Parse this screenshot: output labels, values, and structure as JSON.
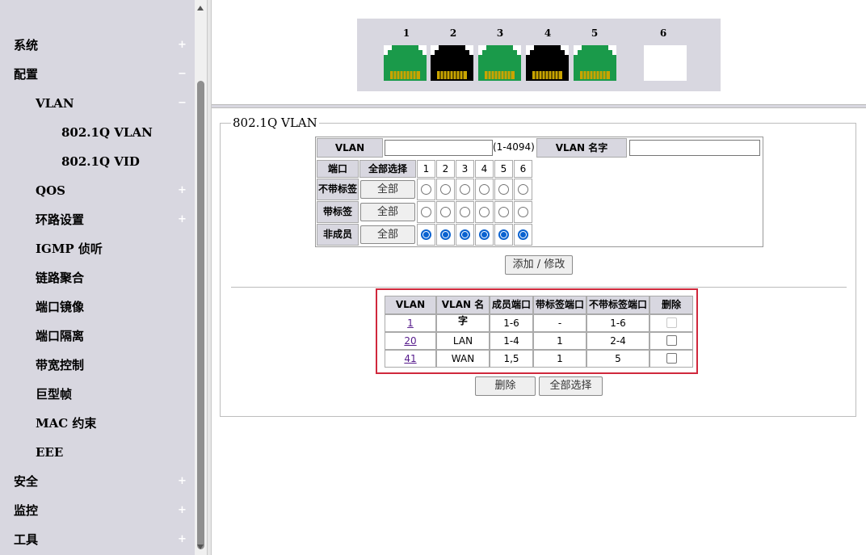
{
  "sidebar": {
    "items": [
      {
        "label": "系统",
        "sign": "+"
      },
      {
        "label": "配置",
        "sign": "−"
      },
      {
        "label": "VLAN",
        "sign": "−"
      },
      {
        "label": "802.1Q VLAN",
        "sign": ""
      },
      {
        "label": "802.1Q VID",
        "sign": ""
      },
      {
        "label": "QOS",
        "sign": "+"
      },
      {
        "label": "环路设置",
        "sign": "+"
      },
      {
        "label": "IGMP 侦听",
        "sign": ""
      },
      {
        "label": "链路聚合",
        "sign": ""
      },
      {
        "label": "端口镜像",
        "sign": ""
      },
      {
        "label": "端口隔离",
        "sign": ""
      },
      {
        "label": "带宽控制",
        "sign": ""
      },
      {
        "label": "巨型帧",
        "sign": ""
      },
      {
        "label": "MAC 约束",
        "sign": ""
      },
      {
        "label": "EEE",
        "sign": ""
      },
      {
        "label": "安全",
        "sign": "+"
      },
      {
        "label": "监控",
        "sign": "+"
      },
      {
        "label": "工具",
        "sign": "+"
      }
    ]
  },
  "ports": [
    {
      "num": "1",
      "status": "up"
    },
    {
      "num": "2",
      "status": "down"
    },
    {
      "num": "3",
      "status": "up"
    },
    {
      "num": "4",
      "status": "down"
    },
    {
      "num": "5",
      "status": "up"
    },
    {
      "num": "6",
      "status": "empty"
    }
  ],
  "colors": {
    "port_up": "#1a9a4a",
    "port_down": "#000000",
    "accent": "#0a62d0",
    "highlight": "#d0283c"
  },
  "form": {
    "legend": "802.1Q VLAN",
    "vlan_label": "VLAN",
    "vlan_value": "",
    "vlan_range": "(1-4094)",
    "name_label": "VLAN 名字",
    "name_value": "",
    "port_col": "端口",
    "select_all_col": "全部选择",
    "port_numbers": [
      "1",
      "2",
      "3",
      "4",
      "5",
      "6"
    ],
    "rows": [
      {
        "label": "不带标签",
        "button": "全部",
        "selected": [
          false,
          false,
          false,
          false,
          false,
          false
        ]
      },
      {
        "label": "带标签",
        "button": "全部",
        "selected": [
          false,
          false,
          false,
          false,
          false,
          false
        ]
      },
      {
        "label": "非成员",
        "button": "全部",
        "selected": [
          true,
          true,
          true,
          true,
          true,
          true
        ]
      }
    ],
    "add_button": "添加 / 修改"
  },
  "vlan_list": {
    "headers": [
      "VLAN",
      "VLAN 名字",
      "成员端口",
      "带标签端口",
      "不带标签端口",
      "删除"
    ],
    "rows": [
      {
        "vlan": "1",
        "name": "",
        "members": "1-6",
        "tagged": "-",
        "untagged": "1-6",
        "delete_disabled": true
      },
      {
        "vlan": "20",
        "name": "LAN",
        "members": "1-4",
        "tagged": "1",
        "untagged": "2-4",
        "delete_disabled": false
      },
      {
        "vlan": "41",
        "name": "WAN",
        "members": "1,5",
        "tagged": "1",
        "untagged": "5",
        "delete_disabled": false
      }
    ],
    "delete_button": "删除",
    "select_all_button": "全部选择"
  }
}
